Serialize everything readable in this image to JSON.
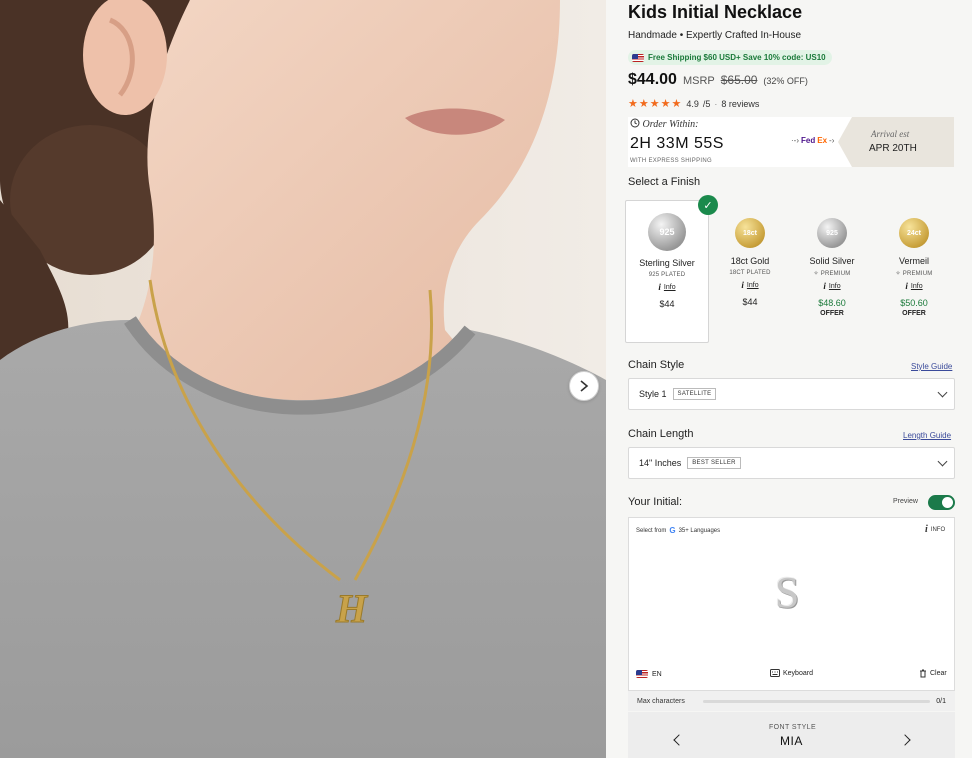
{
  "product": {
    "title": "Kids Initial Necklace",
    "subtitle": "Handmade • Expertly Crafted In-House",
    "shipping_promo": "Free Shipping $60 USD+ Save 10% code: US10",
    "price": "$44.00",
    "msrp_label": "MSRP",
    "msrp_price": "$65.00",
    "discount": "(32% OFF)",
    "stars": "★★★★★",
    "rating": "4.9",
    "rating_scale": "/5",
    "reviews": "8 reviews"
  },
  "gallery": {
    "pendant_letter": "H"
  },
  "delivery": {
    "order_within_label": "Order Within:",
    "countdown": "2H 33M 55S",
    "express_note": "WITH EXPRESS SHIPPING",
    "carrier_fed": "Fed",
    "carrier_ex": "Ex",
    "arrival_label": "Arrival est",
    "arrival_date": "APR 20TH"
  },
  "finish": {
    "label": "Select a Finish",
    "selected_index": 0,
    "options": [
      {
        "coin": "925",
        "name": "Sterling Silver",
        "sub": "925 PLATED",
        "info": "Info",
        "price": "$44",
        "offer": ""
      },
      {
        "coin": "18ct",
        "name": "18ct Gold",
        "sub": "18CT PLATED",
        "info": "Info",
        "price": "$44",
        "offer": ""
      },
      {
        "coin": "925",
        "name": "Solid Silver",
        "sub": "PREMIUM",
        "info": "Info",
        "price": "$48.60",
        "offer": "OFFER"
      },
      {
        "coin": "24ct",
        "name": "Vermeil",
        "sub": "PREMIUM",
        "info": "Info",
        "price": "$50.60",
        "offer": "OFFER"
      }
    ]
  },
  "chain_style": {
    "label": "Chain Style",
    "guide": "Style Guide",
    "value": "Style 1",
    "tag": "SATELLITE"
  },
  "chain_length": {
    "label": "Chain Length",
    "guide": "Length Guide",
    "value": "14\" Inches",
    "tag": "BEST SELLER"
  },
  "initial": {
    "label": "Your Initial:",
    "preview_label": "Preview",
    "preview_on": true,
    "lang_note_prefix": "Select from",
    "lang_note_g": "G",
    "lang_note_suffix": "35+ Languages",
    "info": "INFO",
    "preview_letter": "S",
    "lang": "EN",
    "keyboard": "Keyboard",
    "clear": "Clear",
    "max_label": "Max characters",
    "max_count": "0/1",
    "font_style_label": "FONT STYLE",
    "font_style_value": "MIA"
  },
  "colors": {
    "accent_green": "#1b7a4a",
    "star_orange": "#f26b1d",
    "link_blue": "#3a4a9a"
  }
}
